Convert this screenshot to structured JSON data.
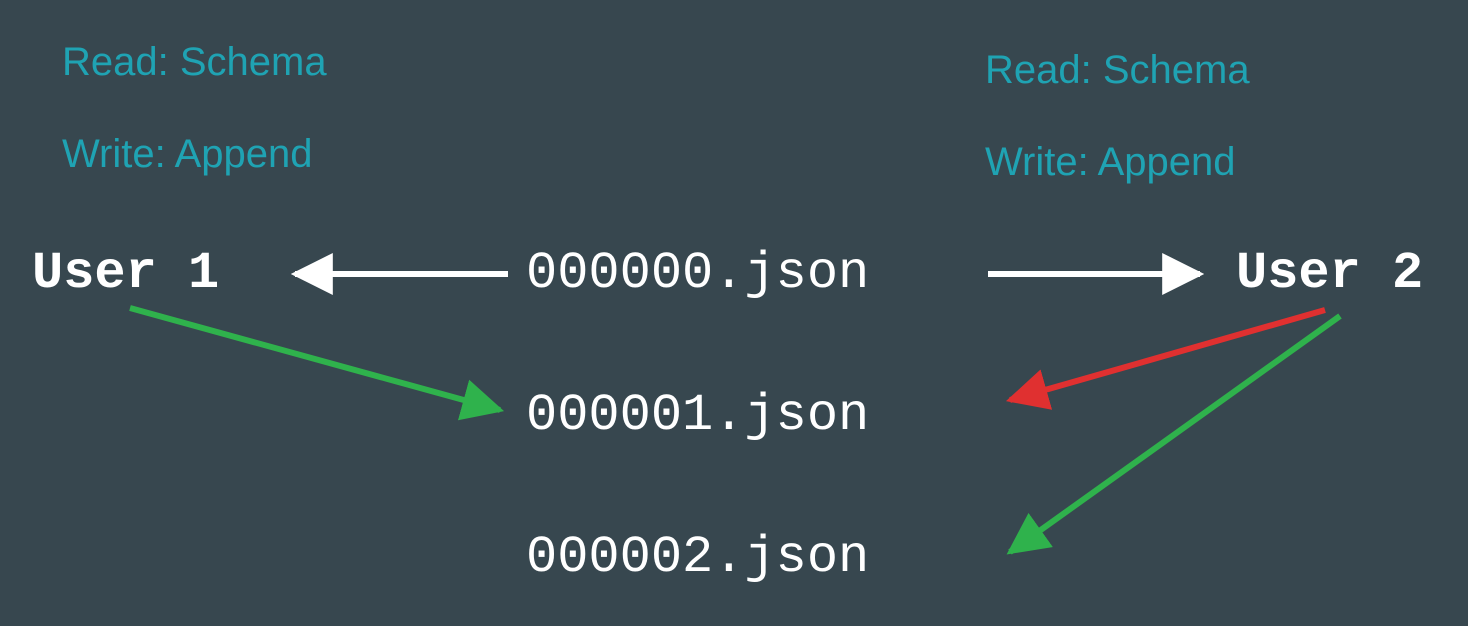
{
  "user1": {
    "read": "Read: Schema",
    "write": "Write: Append",
    "label": "User 1"
  },
  "user2": {
    "read": "Read: Schema",
    "write": "Write: Append",
    "label": "User 2"
  },
  "files": {
    "f0": "000000.json",
    "f1": "000001.json",
    "f2": "000002.json"
  },
  "colors": {
    "permission_text": "#1fa3b3",
    "node_text": "#ffffff",
    "arrow_white": "#ffffff",
    "arrow_green": "#2fb24c",
    "arrow_red": "#e03030",
    "background": "#37474f"
  },
  "arrows": [
    {
      "from": "file0",
      "to": "user1",
      "color": "white",
      "meaning": "user1 reads schema 000000.json"
    },
    {
      "from": "file0",
      "to": "user2",
      "color": "white",
      "meaning": "user2 reads schema 000000.json"
    },
    {
      "from": "user1",
      "to": "file1",
      "color": "green",
      "meaning": "user1 successfully appends 000001.json"
    },
    {
      "from": "user2",
      "to": "file1",
      "color": "red",
      "meaning": "user2 attempt to append 000001.json conflicts"
    },
    {
      "from": "user2",
      "to": "file2",
      "color": "green",
      "meaning": "user2 successfully appends 000002.json"
    }
  ]
}
